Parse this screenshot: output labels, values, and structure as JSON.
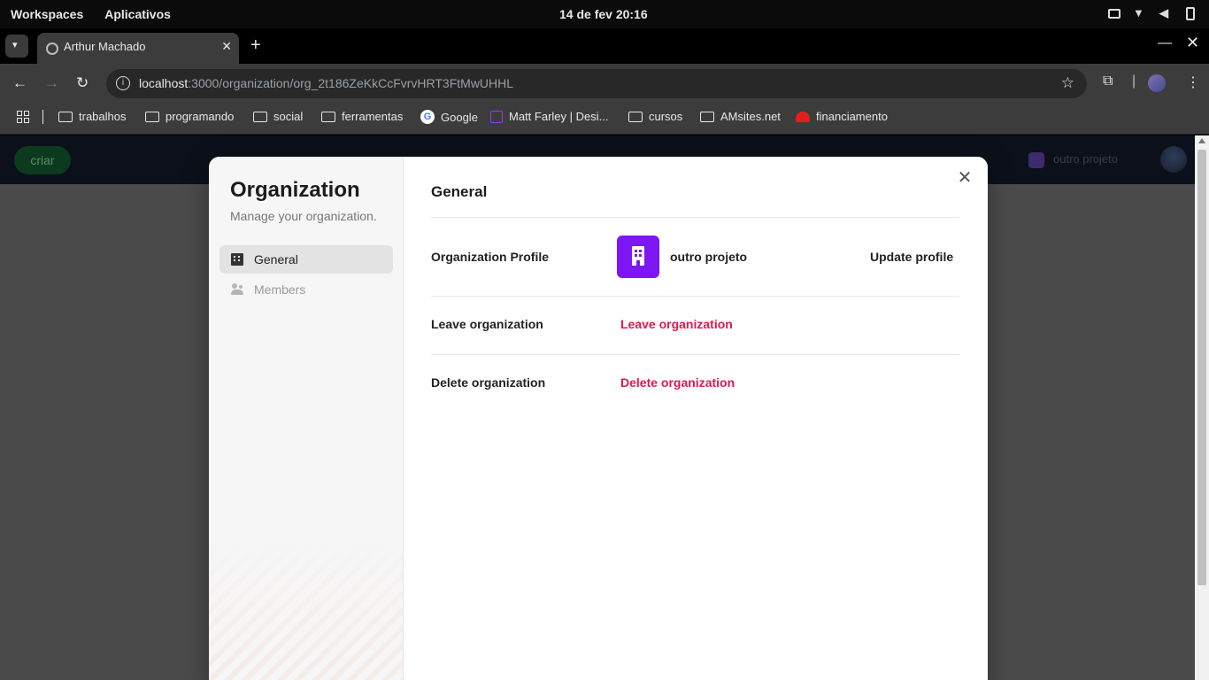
{
  "os": {
    "workspaces": "Workspaces",
    "apps": "Aplicativos",
    "datetime": "14 de fev  20:16"
  },
  "browser": {
    "tab_title": "Arthur Machado",
    "url_host": "localhost",
    "url_rest": ":3000/organization/org_2t186ZeKkCcFvrvHRT3FtMwUHHL",
    "bookmarks": [
      "trabalhos",
      "programando",
      "social",
      "ferramentas",
      "Google",
      "Matt Farley | Desi...",
      "cursos",
      "AMsites.net",
      "financiamento"
    ]
  },
  "app": {
    "create_button": "criar",
    "org_switcher": "outro projeto"
  },
  "modal": {
    "sidebar": {
      "title": "Organization",
      "subtitle": "Manage your organization.",
      "items": [
        {
          "label": "General",
          "icon": "building-icon"
        },
        {
          "label": "Members",
          "icon": "members-icon"
        }
      ]
    },
    "main": {
      "title": "General",
      "profile_label": "Organization Profile",
      "org_name": "outro projeto",
      "update_profile": "Update profile",
      "leave_label": "Leave organization",
      "leave_action": "Leave organization",
      "delete_label": "Delete organization",
      "delete_action": "Delete organization"
    },
    "colors": {
      "danger": "#e0194d",
      "org_logo": "#7c16f5"
    }
  }
}
